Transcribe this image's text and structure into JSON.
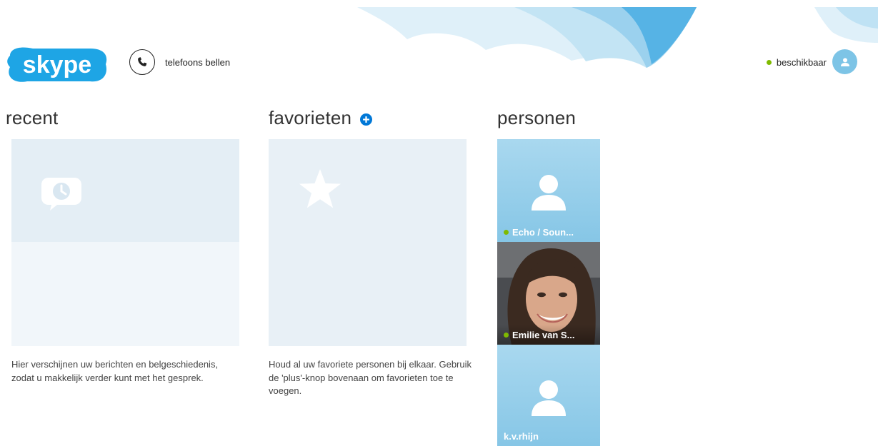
{
  "header": {
    "logo_text": "skype",
    "call_label": "telefoons bellen",
    "status_label": "beschikbaar",
    "status_color": "#7fba00"
  },
  "recent": {
    "title": "recent",
    "description": "Hier verschijnen uw berichten en belgeschiedenis, zodat u makkelijk verder kunt met het gesprek.",
    "icon": "clock-chat-icon"
  },
  "favorites": {
    "title": "favorieten",
    "description": "Houd al uw favoriete personen bij elkaar. Gebruik de 'plus'-knop bovenaan om favorieten toe te voegen.",
    "icon": "star-icon",
    "add_icon": "plus-circle-icon"
  },
  "people": {
    "title": "personen",
    "contacts": [
      {
        "name": "Echo / Soun...",
        "online": true,
        "picture": "silhouette"
      },
      {
        "name": "Emilie van S...",
        "online": true,
        "picture": "photo"
      },
      {
        "name": "k.v.rhijn",
        "online": false,
        "picture": "silhouette"
      }
    ]
  },
  "colors": {
    "accent": "#0078d7",
    "tile_blue": "#86c6e6",
    "tile_light": "#e8f0f6",
    "online": "#7fba00"
  }
}
